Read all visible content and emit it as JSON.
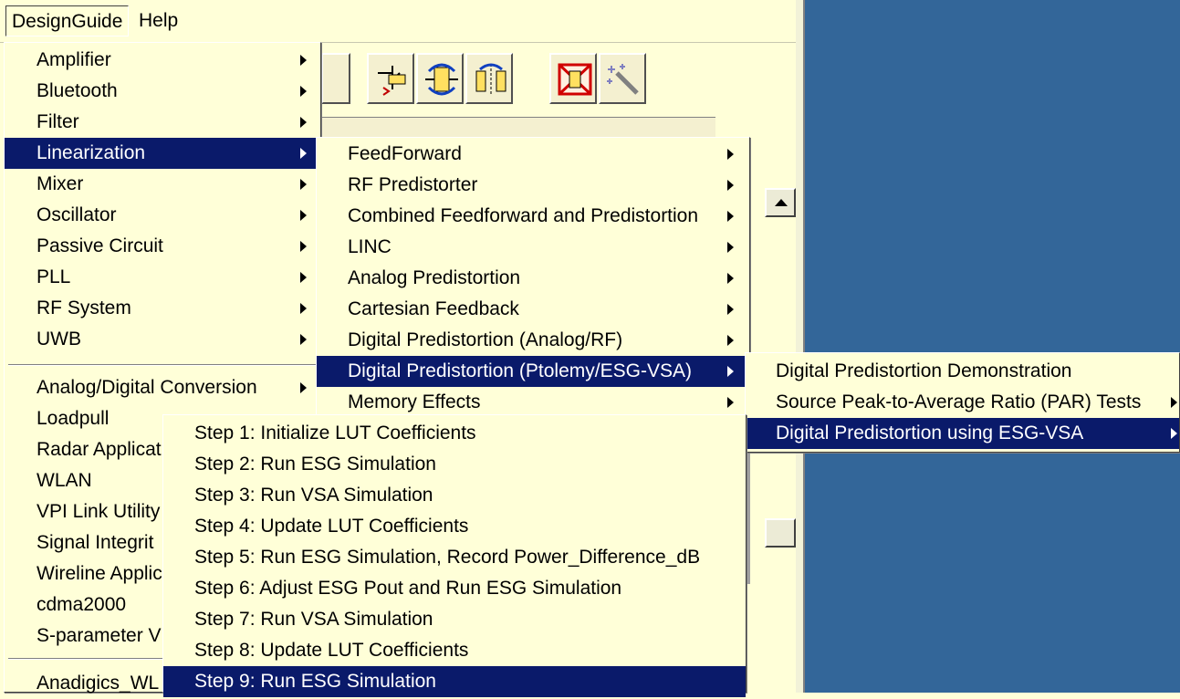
{
  "menubar": {
    "items": [
      "DesignGuide",
      "Help"
    ]
  },
  "main_menu": {
    "group1": [
      "Amplifier",
      "Bluetooth",
      "Filter",
      "Linearization",
      "Mixer",
      "Oscillator",
      "Passive Circuit",
      "PLL",
      "RF System",
      "UWB"
    ],
    "group2": [
      "Analog/Digital Conversion",
      "Loadpull",
      "Radar Applicat",
      "WLAN",
      "VPI Link Utility",
      "Signal Integrit",
      "Wireline Applic",
      "cdma2000",
      "S-parameter V"
    ],
    "group3": [
      "Anadigics_WL"
    ],
    "selected": "Linearization"
  },
  "linearization_menu": {
    "items": [
      "FeedForward",
      "RF Predistorter",
      "Combined Feedforward and Predistortion",
      "LINC",
      "Analog Predistortion",
      "Cartesian Feedback",
      "Digital Predistortion (Analog/RF)",
      "Digital Predistortion (Ptolemy/ESG-VSA)",
      "Memory Effects"
    ],
    "selected": "Digital Predistortion (Ptolemy/ESG-VSA)"
  },
  "dpd_menu": {
    "items": [
      "Digital Predistortion Demonstration",
      "Source Peak-to-Average Ratio (PAR) Tests",
      "Digital Predistortion using ESG-VSA"
    ],
    "selected": "Digital Predistortion using ESG-VSA"
  },
  "steps_menu": {
    "items": [
      "Step 1: Initialize LUT Coefficients",
      "Step 2: Run ESG Simulation",
      "Step 3: Run VSA Simulation",
      "Step 4: Update LUT Coefficients",
      "Step 5: Run ESG Simulation, Record Power_Difference_dB",
      "Step 6: Adjust ESG Pout and Run ESG Simulation",
      "Step 7: Run VSA Simulation",
      "Step 8: Update LUT Coefficients",
      "Step 9: Run ESG Simulation"
    ],
    "selected": "Step 9: Run ESG Simulation"
  },
  "toolbar_icons": [
    "insert-wire-icon",
    "rotate-component-icon",
    "mirror-component-icon",
    "deactivate-component-icon",
    "magic-wand-icon"
  ],
  "colors": {
    "background": "#ffffd8",
    "selection": "#0a1a6a",
    "desktop": "#336699"
  }
}
